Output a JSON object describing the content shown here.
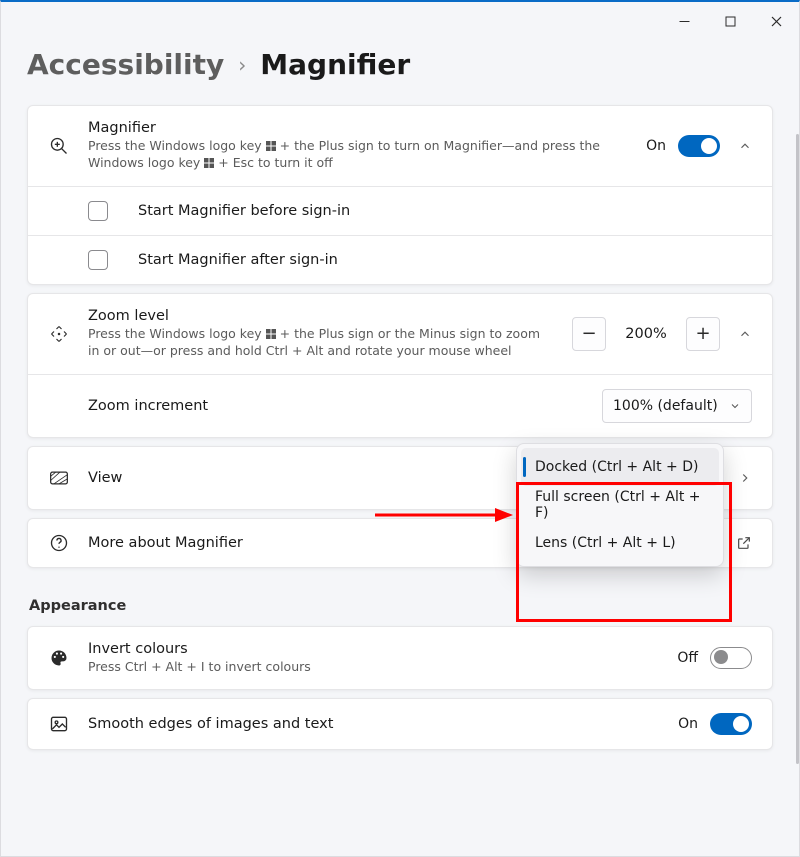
{
  "breadcrumb": {
    "parent": "Accessibility",
    "current": "Magnifier"
  },
  "magnifier": {
    "title": "Magnifier",
    "sub_a": "Press the Windows logo key ",
    "sub_b": " + the Plus sign to turn on Magnifier—and press the Windows logo key ",
    "sub_c": " + Esc to turn it off",
    "state_label": "On",
    "state": true,
    "before_signin": "Start Magnifier before sign-in",
    "after_signin": "Start Magnifier after sign-in"
  },
  "zoom": {
    "title": "Zoom level",
    "sub_a": "Press the Windows logo key ",
    "sub_b": " + the Plus sign or the Minus sign to zoom in or out—or press and hold Ctrl + Alt and rotate your mouse wheel",
    "value": "200%",
    "increment_label": "Zoom increment",
    "increment_value": "100% (default)"
  },
  "view": {
    "title": "View",
    "options": [
      "Docked (Ctrl + Alt + D)",
      "Full screen (Ctrl + Alt + F)",
      "Lens (Ctrl + Alt + L)"
    ],
    "selected_index": 0
  },
  "more": {
    "title": "More about Magnifier"
  },
  "appearance": {
    "section": "Appearance",
    "invert_title": "Invert colours",
    "invert_sub": "Press Ctrl + Alt + I to invert colours",
    "invert_state_label": "Off",
    "smooth_title": "Smooth edges of images and text",
    "smooth_state_label": "On"
  }
}
